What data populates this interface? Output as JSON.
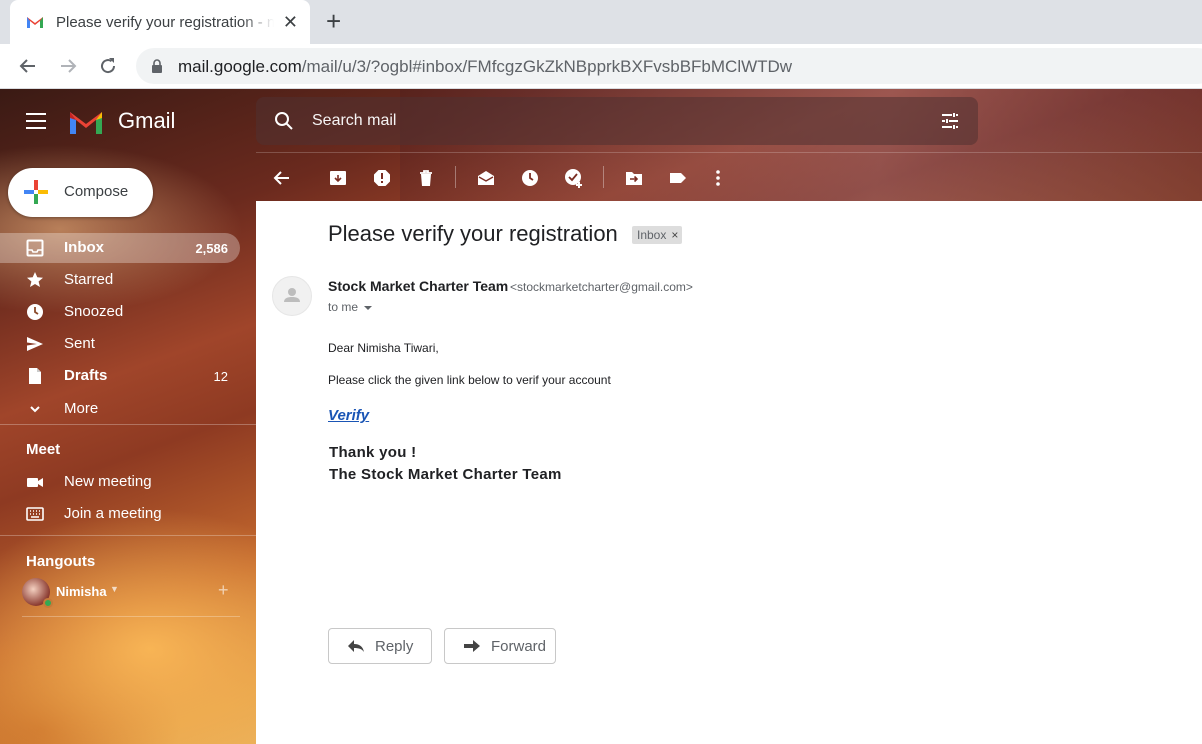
{
  "browser": {
    "tab_title": "Please verify your registration - nimisha",
    "tab_close": "✕",
    "new_tab": "+",
    "url_host": "mail.google.com",
    "url_path": "/mail/u/3/?ogbl#inbox/FMfcgzGkZkNBpprkBXFvsbBFbMClWTDw"
  },
  "header": {
    "product": "Gmail",
    "search_placeholder": "Search mail"
  },
  "sidebar": {
    "compose": "Compose",
    "items": [
      {
        "label": "Inbox",
        "count": "2,586"
      },
      {
        "label": "Starred",
        "count": ""
      },
      {
        "label": "Snoozed",
        "count": ""
      },
      {
        "label": "Sent",
        "count": ""
      },
      {
        "label": "Drafts",
        "count": "12"
      },
      {
        "label": "More",
        "count": ""
      }
    ],
    "meet": {
      "heading": "Meet",
      "new_meeting": "New meeting",
      "join_meeting": "Join a meeting"
    },
    "hangouts": {
      "heading": "Hangouts",
      "user": "Nimisha",
      "add": "+"
    }
  },
  "message": {
    "subject": "Please verify your registration",
    "label": "Inbox",
    "label_remove": "×",
    "sender_name": "Stock Market Charter Team",
    "sender_email": "<stockmarketcharter@gmail.com>",
    "to": "to me",
    "greeting": "Dear Nimisha Tiwari,",
    "instruction": "Please click the given link below to verif your account",
    "link": "Verify",
    "thanks": "Thank you !",
    "signature": "The Stock Market Charter Team",
    "reply": "Reply",
    "forward": "Forward"
  },
  "colors": {
    "link": "#1a55b5",
    "online": "#34a853",
    "gmail_red": "#ea4335"
  }
}
